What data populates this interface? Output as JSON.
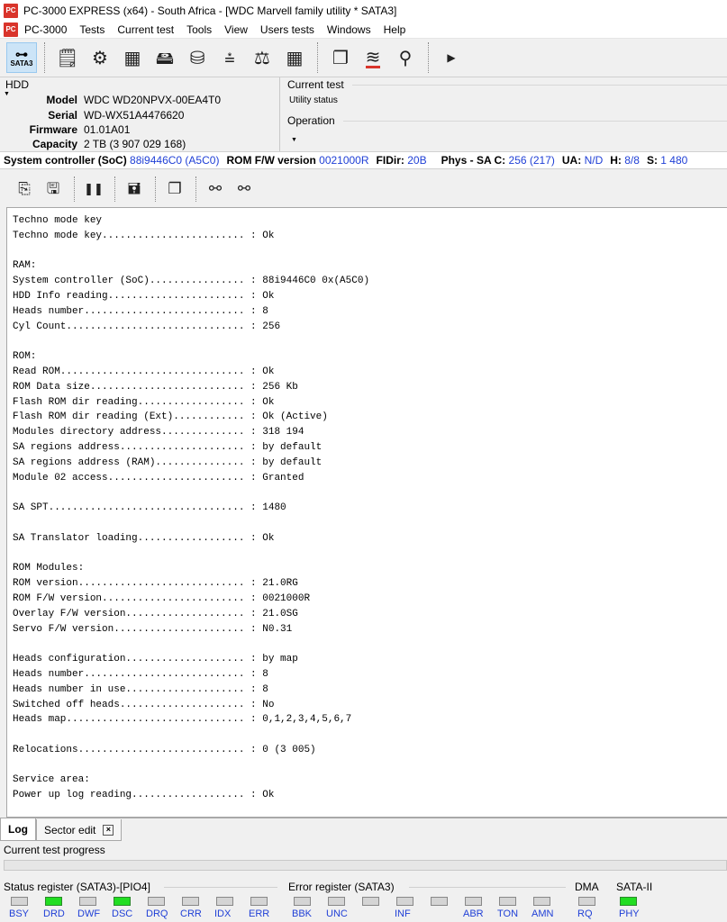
{
  "window": {
    "title": "PC-3000 EXPRESS (x64) - South Africa - [WDC Marvell family utility * SATA3]",
    "app_icon_text": "PC"
  },
  "menu": [
    "PC-3000",
    "Tests",
    "Current test",
    "Tools",
    "View",
    "Users tests",
    "Windows",
    "Help"
  ],
  "toolbar": {
    "sata_label": "SATA3",
    "icons": [
      "sata-icon",
      "notepad-icon",
      "gears-icon",
      "chip-icon",
      "device-icon",
      "drive-icon",
      "flash-tree-icon",
      "balance-icon",
      "grid-icon",
      "copy-icon",
      "disk-stack-icon",
      "wizard-icon",
      "play-arrow-icon"
    ]
  },
  "hdd": {
    "label": "HDD",
    "model_label": "Model",
    "model": "WDC WD20NPVX-00EA4T0",
    "serial_label": "Serial",
    "serial": "WD-WX51A4476620",
    "firmware_label": "Firmware",
    "firmware": "01.01A01",
    "capacity_label": "Capacity",
    "capacity": "2 TB (3 907 029 168)"
  },
  "current_test": {
    "title": "Current test",
    "status": "Utility status",
    "operation": "Operation"
  },
  "sysline": {
    "soc_label": "System controller (SoC)",
    "soc_value": "88i9446C0 (A5C0)",
    "rom_label": "ROM F/W version",
    "rom_value": "0021000R",
    "fidir_label": "FIDir:",
    "fidir_value": "20B",
    "phys_label": "Phys",
    "sac_label": "- SA C:",
    "sac_value": "256 (217)",
    "ua_label": "UA:",
    "ua_value": "N/D",
    "h_label": "H:",
    "h_value": "8/8",
    "s_label": "S:",
    "s_value": "1 480"
  },
  "log_lines": [
    "Techno mode key",
    "Techno mode key........................ : Ok",
    "",
    "RAM:",
    "System controller (SoC)................ : 88i9446C0 0x(A5C0)",
    "HDD Info reading....................... : Ok",
    "Heads number........................... : 8",
    "Cyl Count.............................. : 256",
    "",
    "ROM:",
    "Read ROM............................... : Ok",
    "ROM Data size.......................... : 256 Kb",
    "Flash ROM dir reading.................. : Ok",
    "Flash ROM dir reading (Ext)............ : Ok (Active)",
    "Modules directory address.............. : 318 194",
    "SA regions address..................... : by default",
    "SA regions address (RAM)............... : by default",
    "Module 02 access....................... : Granted",
    "",
    "SA SPT................................. : 1480",
    "",
    "SA Translator loading.................. : Ok",
    "",
    "ROM Modules:",
    "ROM version............................ : 21.0RG",
    "ROM F/W version........................ : 0021000R",
    "Overlay F/W version.................... : 21.0SG",
    "Servo F/W version...................... : N0.31",
    "",
    "Heads configuration.................... : by map",
    "Heads number........................... : 8",
    "Heads number in use.................... : 8",
    "Switched off heads..................... : No",
    "Heads map.............................. : 0,1,2,3,4,5,6,7",
    "",
    "Relocations............................ : 0 (3 005)",
    "",
    "Service area:",
    "Power up log reading................... : Ok"
  ],
  "tabs": {
    "log": "Log",
    "sector_edit": "Sector edit",
    "close_glyph": "×"
  },
  "progress": {
    "label": "Current test progress",
    "value": 0
  },
  "status_register": {
    "title": "Status register (SATA3)-[PIO4]",
    "leds": [
      {
        "name": "BSY",
        "on": false
      },
      {
        "name": "DRD",
        "on": true
      },
      {
        "name": "DWF",
        "on": false
      },
      {
        "name": "DSC",
        "on": true
      },
      {
        "name": "DRQ",
        "on": false
      },
      {
        "name": "CRR",
        "on": false
      },
      {
        "name": "IDX",
        "on": false
      },
      {
        "name": "ERR",
        "on": false
      }
    ]
  },
  "error_register": {
    "title": "Error register (SATA3)",
    "leds": [
      {
        "name": "BBK",
        "on": false
      },
      {
        "name": "UNC",
        "on": false
      },
      {
        "name": "",
        "on": false
      },
      {
        "name": "INF",
        "on": false
      },
      {
        "name": "",
        "on": false
      },
      {
        "name": "ABR",
        "on": false
      },
      {
        "name": "TON",
        "on": false
      },
      {
        "name": "AMN",
        "on": false
      }
    ]
  },
  "dma": {
    "title": "DMA",
    "led_name": "RQ",
    "on": false
  },
  "sata": {
    "title": "SATA-II",
    "led_name": "PHY",
    "on": true
  }
}
